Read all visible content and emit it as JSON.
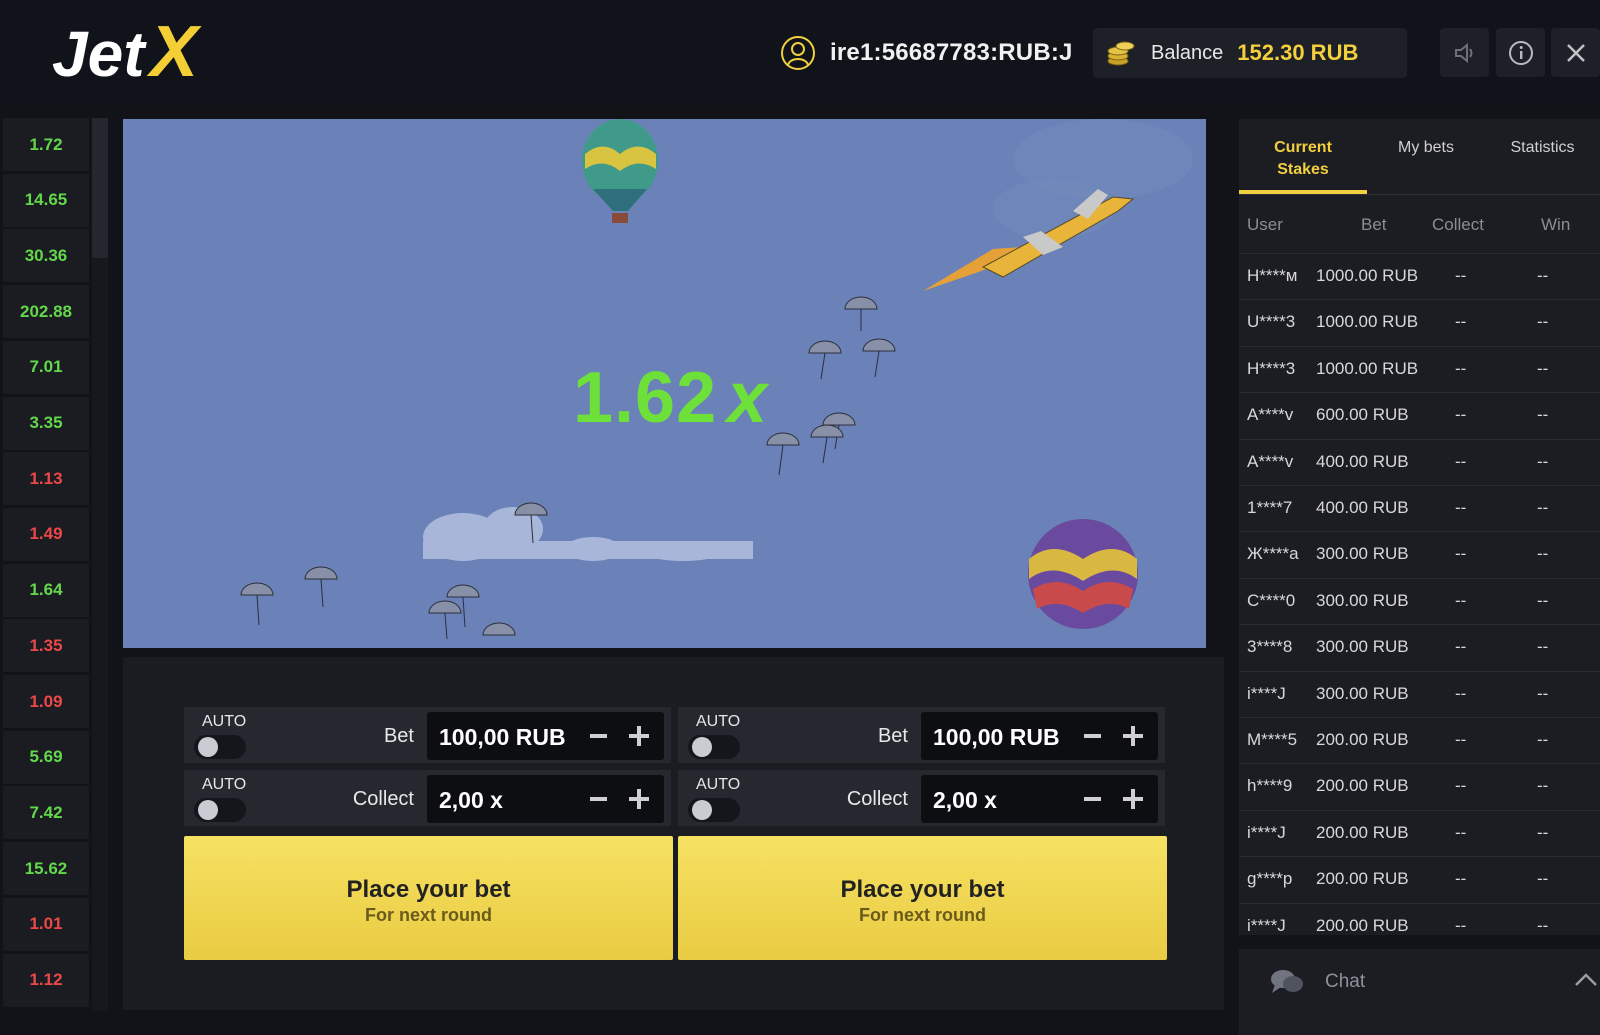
{
  "header": {
    "username": "ire1:56687783:RUB:J",
    "balance_label": "Balance",
    "balance_value": "152.30 RUB"
  },
  "history": [
    {
      "value": "1.72",
      "color": "green"
    },
    {
      "value": "14.65",
      "color": "green"
    },
    {
      "value": "30.36",
      "color": "green"
    },
    {
      "value": "202.88",
      "color": "green"
    },
    {
      "value": "7.01",
      "color": "green"
    },
    {
      "value": "3.35",
      "color": "green"
    },
    {
      "value": "1.13",
      "color": "red"
    },
    {
      "value": "1.49",
      "color": "red"
    },
    {
      "value": "1.64",
      "color": "green"
    },
    {
      "value": "1.35",
      "color": "red"
    },
    {
      "value": "1.09",
      "color": "red"
    },
    {
      "value": "5.69",
      "color": "green"
    },
    {
      "value": "7.42",
      "color": "green"
    },
    {
      "value": "15.62",
      "color": "green"
    },
    {
      "value": "1.01",
      "color": "red"
    },
    {
      "value": "1.12",
      "color": "red"
    }
  ],
  "game": {
    "multiplier": "1.62",
    "multiplier_suffix": "x"
  },
  "panels": [
    {
      "auto_label": "AUTO",
      "bet_label": "Bet",
      "bet_value": "100,00 RUB",
      "collect_auto_label": "AUTO",
      "collect_label": "Collect",
      "collect_value": "2,00 x",
      "button_main": "Place your bet",
      "button_sub": "For next round"
    },
    {
      "auto_label": "AUTO",
      "bet_label": "Bet",
      "bet_value": "100,00 RUB",
      "collect_auto_label": "AUTO",
      "collect_label": "Collect",
      "collect_value": "2,00 x",
      "button_main": "Place your bet",
      "button_sub": "For next round"
    }
  ],
  "stakes": {
    "tabs": [
      "Current Stakes",
      "My bets",
      "Statistics"
    ],
    "columns": [
      "User",
      "Bet",
      "Collect",
      "Win"
    ],
    "rows": [
      {
        "user": "H****м",
        "bet": "1000.00 RUB",
        "collect": "--",
        "win": "--"
      },
      {
        "user": "U****3",
        "bet": "1000.00 RUB",
        "collect": "--",
        "win": "--"
      },
      {
        "user": "H****3",
        "bet": "1000.00 RUB",
        "collect": "--",
        "win": "--"
      },
      {
        "user": "A****v",
        "bet": "600.00 RUB",
        "collect": "--",
        "win": "--"
      },
      {
        "user": "A****v",
        "bet": "400.00 RUB",
        "collect": "--",
        "win": "--"
      },
      {
        "user": "1****7",
        "bet": "400.00 RUB",
        "collect": "--",
        "win": "--"
      },
      {
        "user": "Ж****a",
        "bet": "300.00 RUB",
        "collect": "--",
        "win": "--"
      },
      {
        "user": "C****0",
        "bet": "300.00 RUB",
        "collect": "--",
        "win": "--"
      },
      {
        "user": "3****8",
        "bet": "300.00 RUB",
        "collect": "--",
        "win": "--"
      },
      {
        "user": "i****J",
        "bet": "300.00 RUB",
        "collect": "--",
        "win": "--"
      },
      {
        "user": "M****5",
        "bet": "200.00 RUB",
        "collect": "--",
        "win": "--"
      },
      {
        "user": "h****9",
        "bet": "200.00 RUB",
        "collect": "--",
        "win": "--"
      },
      {
        "user": "i****J",
        "bet": "200.00 RUB",
        "collect": "--",
        "win": "--"
      },
      {
        "user": "g****p",
        "bet": "200.00 RUB",
        "collect": "--",
        "win": "--"
      },
      {
        "user": "i****J",
        "bet": "200.00 RUB",
        "collect": "--",
        "win": "--"
      }
    ]
  },
  "chat": {
    "label": "Chat"
  },
  "colors": {
    "accent": "#f2cf3e",
    "win_green": "#62d84a",
    "loss_red": "#ec4848",
    "multiplier_green": "#6ee03a"
  }
}
